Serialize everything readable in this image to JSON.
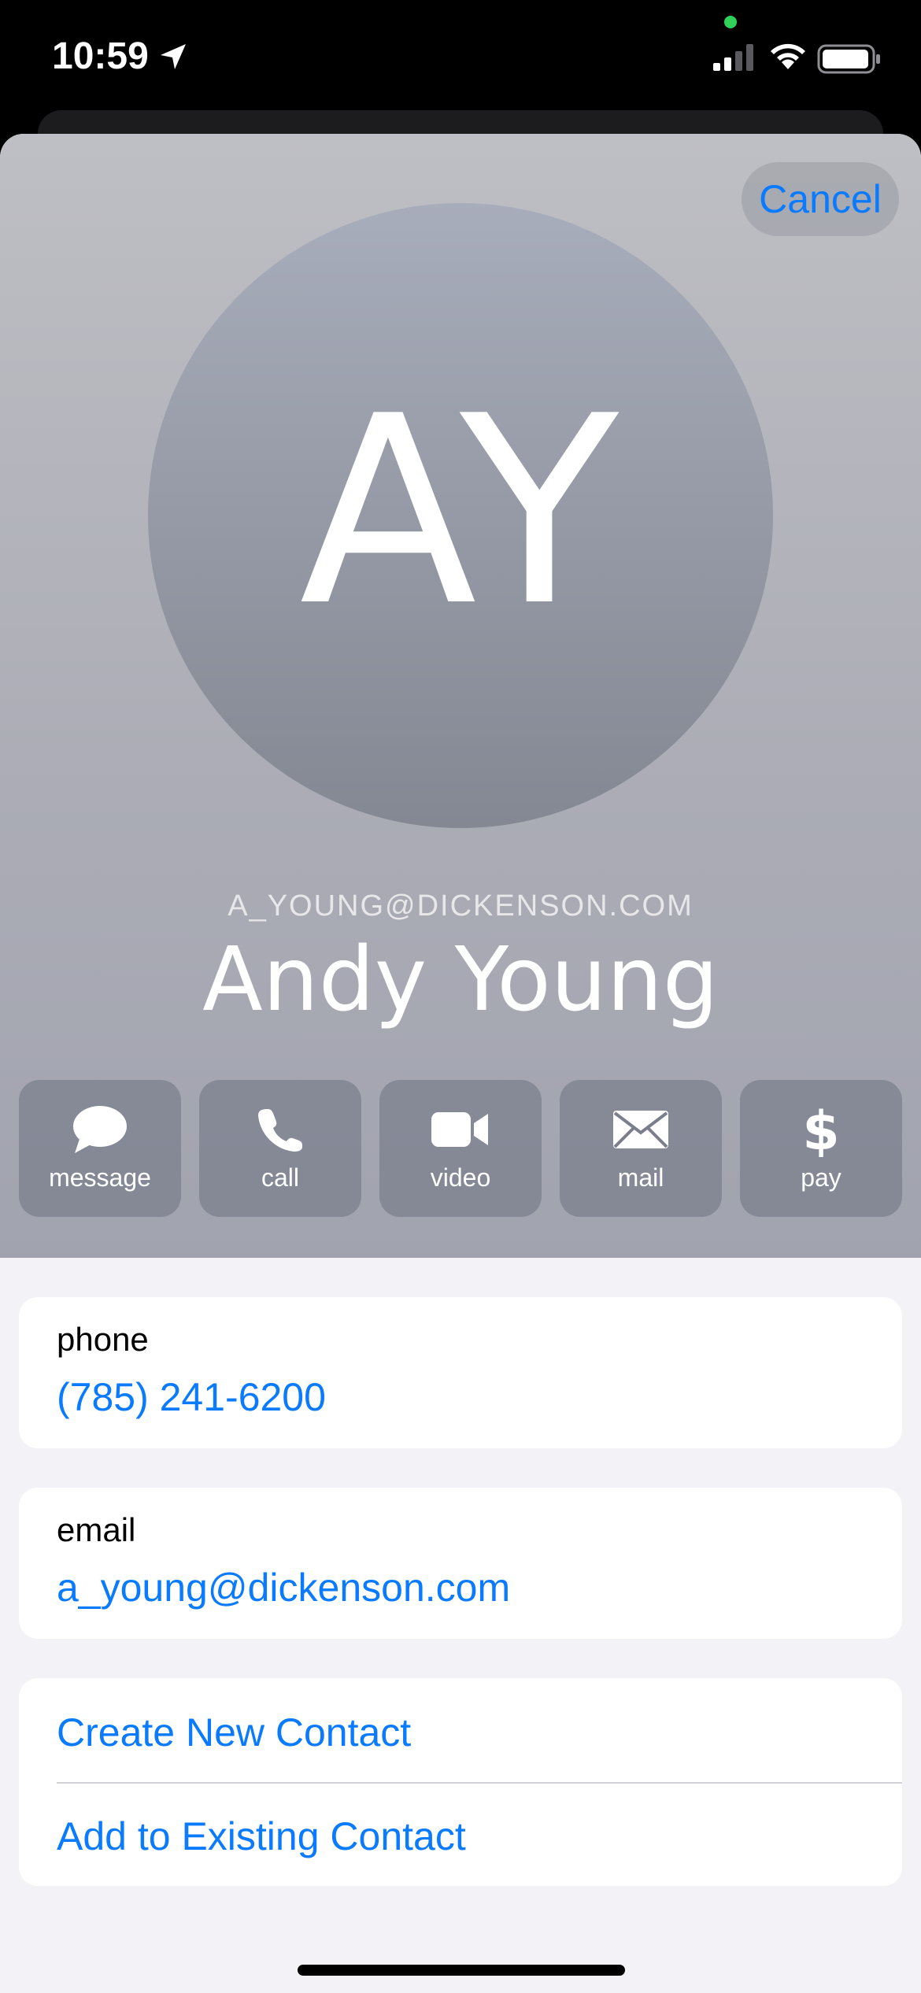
{
  "status_bar": {
    "time": "10:59"
  },
  "sheet": {
    "cancel_label": "Cancel"
  },
  "contact": {
    "initials": "AY",
    "subtitle": "A_YOUNG@DICKENSON.COM",
    "name": "Andy Young"
  },
  "actions": [
    {
      "label": "message",
      "icon": "message-bubble-icon"
    },
    {
      "label": "call",
      "icon": "phone-icon"
    },
    {
      "label": "video",
      "icon": "video-camera-icon"
    },
    {
      "label": "mail",
      "icon": "envelope-icon"
    },
    {
      "label": "pay",
      "icon": "dollar-icon"
    }
  ],
  "fields": {
    "phone": {
      "label": "phone",
      "value": "(785) 241-6200"
    },
    "email": {
      "label": "email",
      "value": "a_young@dickenson.com"
    }
  },
  "links": {
    "create_new": "Create New Contact",
    "add_existing": "Add to Existing Contact"
  },
  "colors": {
    "accent": "#0A7AFF",
    "status_dot": "#30D158"
  }
}
